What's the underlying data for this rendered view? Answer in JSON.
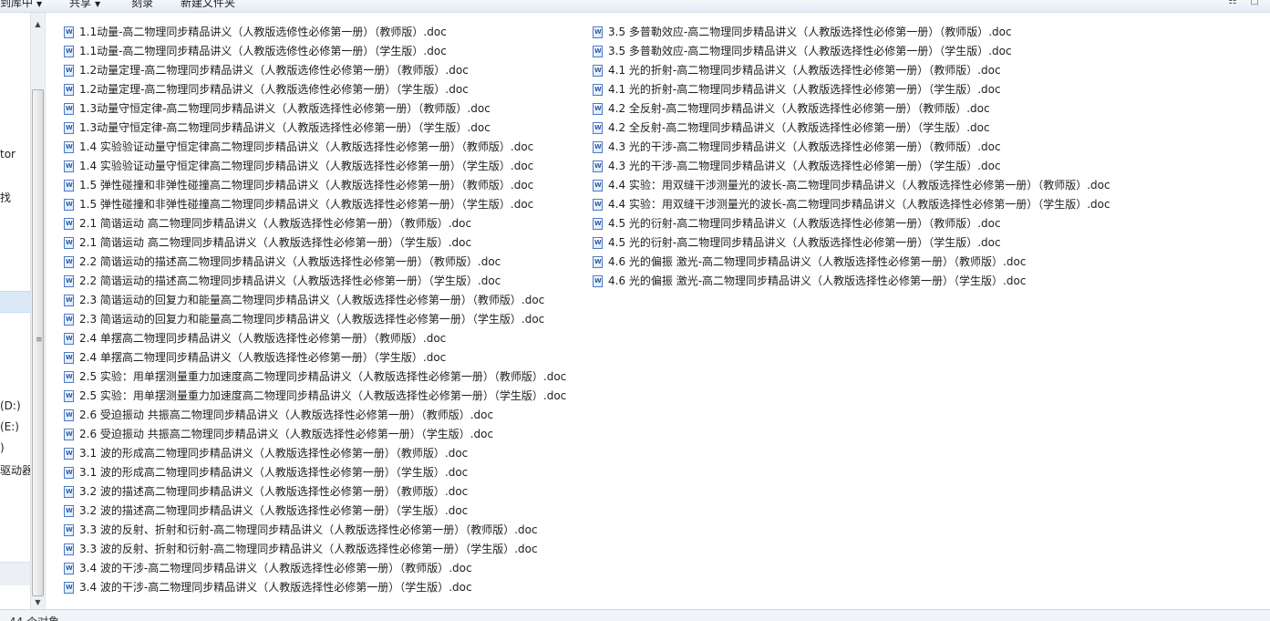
{
  "toolbar": {
    "items": [
      {
        "label": "到库中"
      },
      {
        "label": "共享"
      },
      {
        "label": "刻录"
      },
      {
        "label": "新建文件夹"
      }
    ],
    "right_icons": "☷ □"
  },
  "nav": {
    "items": [
      {
        "label": "tor"
      },
      {
        "label": "找"
      },
      {
        "label": "(D:)"
      },
      {
        "label": "(E:)"
      },
      {
        "label": ")"
      },
      {
        "label": "驱动器"
      }
    ]
  },
  "files": {
    "icon": "word-doc-icon",
    "column_1": [
      "1.1动量-高二物理同步精品讲义（人教版选修性必修第一册）（教师版）.doc",
      "1.1动量-高二物理同步精品讲义（人教版选修性必修第一册）（学生版）.doc",
      "1.2动量定理-高二物理同步精品讲义（人教版选修性必修第一册）（教师版）.doc",
      "1.2动量定理-高二物理同步精品讲义（人教版选修性必修第一册）（学生版）.doc",
      "1.3动量守恒定律-高二物理同步精品讲义（人教版选择性必修第一册）（教师版）.doc",
      "1.3动量守恒定律-高二物理同步精品讲义（人教版选择性必修第一册）（学生版）.doc",
      "1.4 实验验证动量守恒定律高二物理同步精品讲义（人教版选择性必修第一册）（教师版）.doc",
      "1.4 实验验证动量守恒定律高二物理同步精品讲义（人教版选择性必修第一册）（学生版）.doc",
      "1.5 弹性碰撞和非弹性碰撞高二物理同步精品讲义（人教版选择性必修第一册）（教师版）.doc",
      "1.5 弹性碰撞和非弹性碰撞高二物理同步精品讲义（人教版选择性必修第一册）（学生版）.doc",
      "2.1  简谐运动 高二物理同步精品讲义（人教版选择性必修第一册）（教师版）.doc",
      "2.1  简谐运动 高二物理同步精品讲义（人教版选择性必修第一册）（学生版）.doc",
      "2.2  简谐运动的描述高二物理同步精品讲义（人教版选择性必修第一册）（教师版）.doc",
      "2.2  简谐运动的描述高二物理同步精品讲义（人教版选择性必修第一册）（学生版）.doc",
      "2.3  简谐运动的回复力和能量高二物理同步精品讲义（人教版选择性必修第一册）（教师版）.doc",
      "2.3  简谐运动的回复力和能量高二物理同步精品讲义（人教版选择性必修第一册）（学生版）.doc",
      "2.4  单摆高二物理同步精品讲义（人教版选择性必修第一册）（教师版）.doc",
      "2.4  单摆高二物理同步精品讲义（人教版选择性必修第一册）（学生版）.doc",
      "2.5  实验：用单摆测量重力加速度高二物理同步精品讲义（人教版选择性必修第一册）（教师版）.doc",
      "2.5  实验：用单摆测量重力加速度高二物理同步精品讲义（人教版选择性必修第一册）（学生版）.doc",
      "2.6  受迫振动 共振高二物理同步精品讲义（人教版选择性必修第一册）（教师版）.doc",
      "2.6  受迫振动 共振高二物理同步精品讲义（人教版选择性必修第一册）（学生版）.doc",
      "3.1  波的形成高二物理同步精品讲义（人教版选择性必修第一册）（教师版）.doc",
      "3.1  波的形成高二物理同步精品讲义（人教版选择性必修第一册）（学生版）.doc",
      "3.2 波的描述高二物理同步精品讲义（人教版选择性必修第一册）（教师版）.doc",
      "3.2 波的描述高二物理同步精品讲义（人教版选择性必修第一册）（学生版）.doc",
      "3.3 波的反射、折射和衍射-高二物理同步精品讲义（人教版选择性必修第一册）（教师版）.doc",
      "3.3 波的反射、折射和衍射-高二物理同步精品讲义（人教版选择性必修第一册）（学生版）.doc",
      "3.4 波的干涉-高二物理同步精品讲义（人教版选择性必修第一册）（教师版）.doc",
      "3.4 波的干涉-高二物理同步精品讲义（人教版选择性必修第一册）（学生版）.doc"
    ],
    "column_2": [
      "3.5 多普勒效应-高二物理同步精品讲义（人教版选择性必修第一册）（教师版）.doc",
      "3.5 多普勒效应-高二物理同步精品讲义（人教版选择性必修第一册）（学生版）.doc",
      "4.1 光的折射-高二物理同步精品讲义（人教版选择性必修第一册）（教师版）.doc",
      "4.1 光的折射-高二物理同步精品讲义（人教版选择性必修第一册）（学生版）.doc",
      "4.2 全反射-高二物理同步精品讲义（人教版选择性必修第一册）（教师版）.doc",
      "4.2 全反射-高二物理同步精品讲义（人教版选择性必修第一册）（学生版）.doc",
      "4.3 光的干涉-高二物理同步精品讲义（人教版选择性必修第一册）（教师版）.doc",
      "4.3 光的干涉-高二物理同步精品讲义（人教版选择性必修第一册）（学生版）.doc",
      "4.4 实验：用双缝干涉测量光的波长-高二物理同步精品讲义（人教版选择性必修第一册）（教师版）.doc",
      "4.4 实验：用双缝干涉测量光的波长-高二物理同步精品讲义（人教版选择性必修第一册）（学生版）.doc",
      "4.5 光的衍射-高二物理同步精品讲义（人教版选择性必修第一册）（教师版）.doc",
      "4.5 光的衍射-高二物理同步精品讲义（人教版选择性必修第一册）（学生版）.doc",
      "4.6 光的偏振 激光-高二物理同步精品讲义（人教版选择性必修第一册）（教师版）.doc",
      "4.6 光的偏振 激光-高二物理同步精品讲义（人教版选择性必修第一册）（学生版）.doc"
    ]
  },
  "status": {
    "text": "44 个对象"
  }
}
